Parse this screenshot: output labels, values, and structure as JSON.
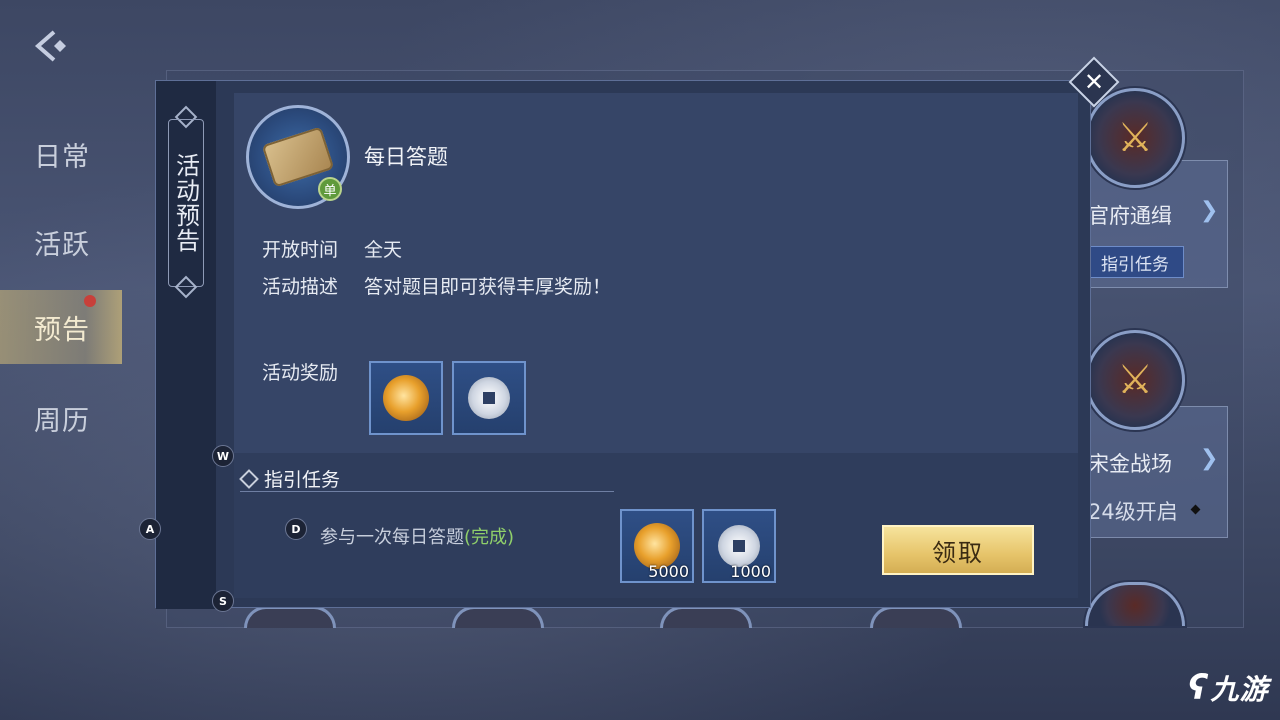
{
  "left_tabs": [
    {
      "label": "日常"
    },
    {
      "label": "活跃"
    },
    {
      "label": "预告"
    },
    {
      "label": "周历"
    }
  ],
  "side_cards": {
    "card1": {
      "title": "官府通缉",
      "button": "指引任务"
    },
    "card2": {
      "title": "宋金战场",
      "level": "24级开启"
    }
  },
  "modal": {
    "vertical_tab": "活动预告",
    "event_title": "每日答题",
    "single_badge": "单",
    "open_time_label": "开放时间",
    "open_time_value": "全天",
    "desc_label": "活动描述",
    "desc_value": "答对题目即可获得丰厚奖励！",
    "reward_label": "活动奖励",
    "guide_header": "指引任务",
    "task_text": "参与一次每日答题",
    "task_status": "(完成)",
    "task_rewards": [
      {
        "qty": "5000"
      },
      {
        "qty": "1000"
      }
    ],
    "claim_button": "领取"
  },
  "key_hints": {
    "w": "W",
    "a": "A",
    "s": "S",
    "d": "D"
  },
  "watermark": "九游",
  "close_symbol": "✕"
}
